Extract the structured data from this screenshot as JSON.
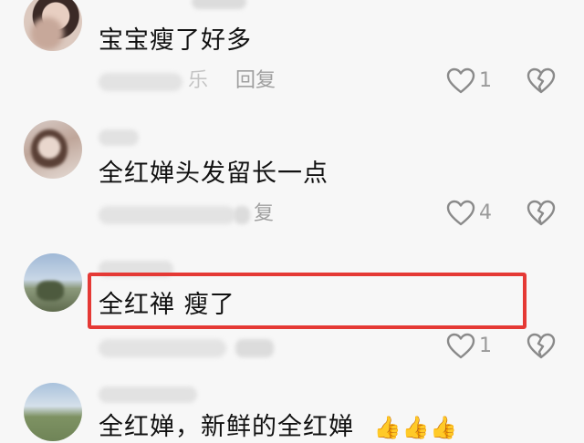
{
  "comments": [
    {
      "text": "宝宝瘦了好多",
      "reply_label": "回复",
      "meta_partial": "乐",
      "likes": "1"
    },
    {
      "text": "全红婵头发留长一点",
      "reply_label": "复",
      "likes": "4"
    },
    {
      "text": "全红禅 瘦了",
      "likes": "1"
    },
    {
      "text": "全红婵，新鲜的全红婵",
      "emoji": "👍👍👍"
    }
  ],
  "colors": {
    "background": "#f7f7f7",
    "highlight_border": "#e53935",
    "meta_text": "#a0a0a0"
  },
  "icons": [
    "heart-outline-icon",
    "broken-heart-icon"
  ]
}
